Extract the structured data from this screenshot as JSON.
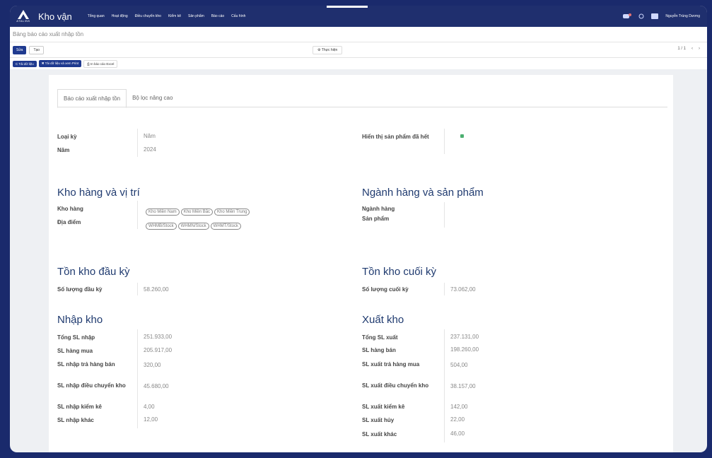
{
  "app": {
    "name": "Kho vận",
    "logo_text": "ATALINK"
  },
  "menu": [
    "Tổng quan",
    "Hoạt động",
    "Điều chuyển kho",
    "Kiểm kê",
    "Sản phẩm",
    "Báo cáo",
    "Cấu hình"
  ],
  "user": {
    "name": "Nguyễn Trùng Dương"
  },
  "breadcrumb": "Bảng báo cáo xuất nhập tồn",
  "controls": {
    "save": "Sửa",
    "create": "Tạo",
    "action": "⚙ Thực hiện",
    "pager": "1 / 1",
    "refresh": "C Tải dữ liệu",
    "refresh_print": "✖ Tải dữ liệu và xem Print",
    "print_excel": "In báo cáo Excel"
  },
  "tabs": [
    "Báo cáo xuất nhập tồn",
    "Bộ lọc nâng cao"
  ],
  "period": {
    "type_label": "Loại kỳ",
    "type_value": "Năm",
    "year_label": "Năm",
    "year_value": "2024",
    "show_label": "Hiển thị sản phẩm đã hết"
  },
  "warehouse": {
    "title": "Kho hàng và vị trí",
    "wh_label": "Kho hàng",
    "wh_tags": [
      "Kho Miền Nam",
      "Kho Miền Bắc",
      "Kho Miền Trung"
    ],
    "loc_label": "Địa điểm",
    "loc_tags": [
      "WHMB/Stock",
      "WHMN/Stock",
      "WHMT/Stock"
    ]
  },
  "category": {
    "title": "Ngành hàng và sản phẩm",
    "cat_label": "Ngành hàng",
    "prod_label": "Sản phẩm"
  },
  "opening": {
    "title": "Tồn kho đầu kỳ",
    "label": "Số lượng đầu kỳ",
    "value": "58.260,00"
  },
  "closing": {
    "title": "Tồn kho cuối kỳ",
    "label": "Số lượng cuối kỳ",
    "value": "73.062,00"
  },
  "import": {
    "title": "Nhập kho",
    "rows": [
      {
        "label": "Tổng SL nhập",
        "value": "251.933,00"
      },
      {
        "label": "SL hàng mua",
        "value": "205.917,00"
      },
      {
        "label": "SL nhập trả hàng bán",
        "value": "320,00"
      },
      {
        "label": "SL nhập điều chuyển kho",
        "value": "45.680,00"
      },
      {
        "label": "SL nhập kiểm kê",
        "value": "4,00"
      },
      {
        "label": "SL nhập khác",
        "value": "12,00"
      }
    ]
  },
  "export": {
    "title": "Xuất kho",
    "rows": [
      {
        "label": "Tổng SL xuất",
        "value": "237.131,00"
      },
      {
        "label": "SL hàng bán",
        "value": "198.260,00"
      },
      {
        "label": "SL xuất trả hàng mua",
        "value": "504,00"
      },
      {
        "label": "SL xuất điều chuyển kho",
        "value": "38.157,00"
      },
      {
        "label": "SL xuất kiểm kê",
        "value": "142,00"
      },
      {
        "label": "SL xuất hủy",
        "value": "22,00"
      },
      {
        "label": "SL xuất khác",
        "value": "46,00"
      }
    ]
  },
  "colors": {
    "navbar": "#1f2f6e",
    "primary": "#1f3a8f",
    "heading": "#1f3a6f",
    "toggle_on": "#4caf70"
  }
}
